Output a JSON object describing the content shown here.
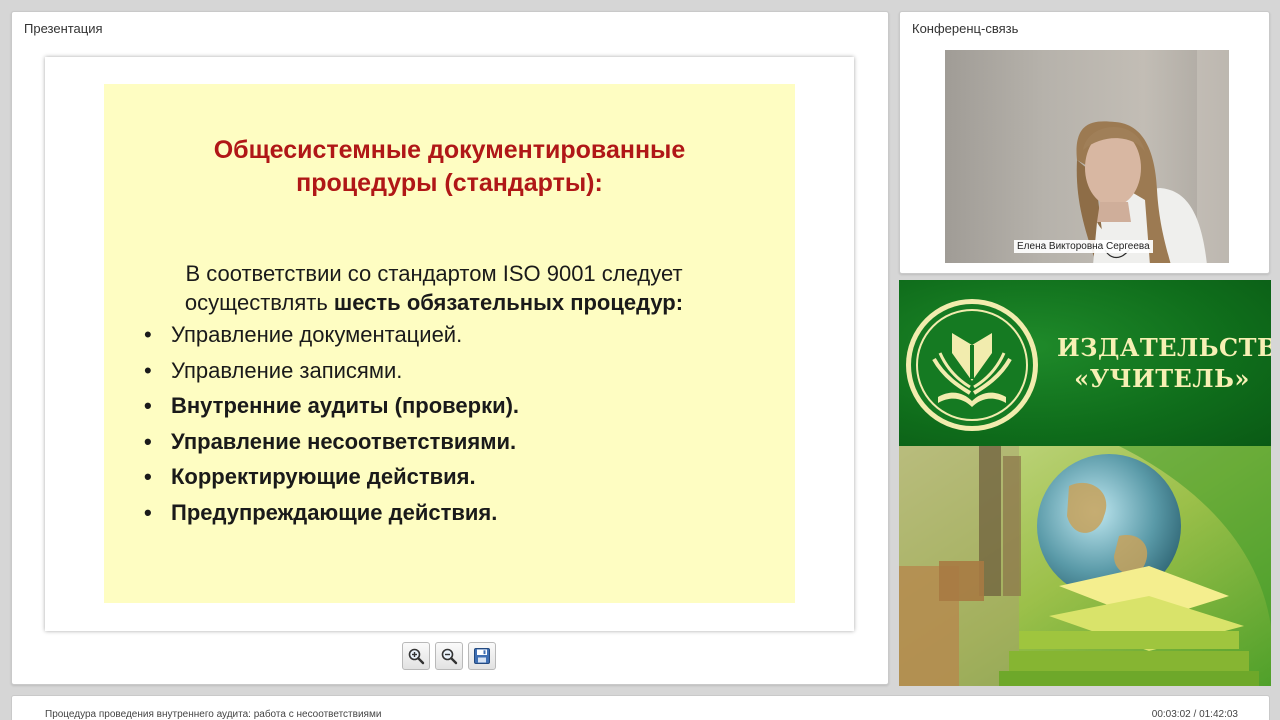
{
  "presentation": {
    "title": "Презентация",
    "slide": {
      "title_line1": "Общесистемные документированные",
      "title_line2": "процедуры (стандарты):",
      "intro_line1": "В соответствии со стандартом ISO 9001 следует",
      "intro_line2_plain": "осуществлять ",
      "intro_line2_bold": "шесть обязательных процедур:",
      "bullets": [
        {
          "text": "Управление документацией.",
          "bold": false
        },
        {
          "text": "Управление записями.",
          "bold": false
        },
        {
          "text": "Внутренние аудиты (проверки).",
          "bold": true
        },
        {
          "text": "Управление несоответствиями.",
          "bold": true
        },
        {
          "text": "Корректирующие действия.",
          "bold": true
        },
        {
          "text": "Предупреждающие действия.",
          "bold": true
        }
      ],
      "background_color": "#fefdc2",
      "title_color": "#b01717"
    },
    "toolbar": {
      "zoom_in_icon": "zoom-in-icon",
      "zoom_out_icon": "zoom-out-icon",
      "save_icon": "save-icon"
    }
  },
  "conference": {
    "title": "Конференц-связь",
    "speaker_name": "Елена Викторовна Сергеева"
  },
  "banner": {
    "brand_line1": "ИЗДАТЕЛЬСТВО",
    "brand_line2": "«УЧИТЕЛЬ»",
    "brand_color": "#0f6d1b"
  },
  "status": {
    "lesson_title": "Процедура проведения внутреннего аудита:  работа с несоответствиями",
    "elapsed": "00:03:02",
    "separator": " / ",
    "total": "01:42:03"
  }
}
